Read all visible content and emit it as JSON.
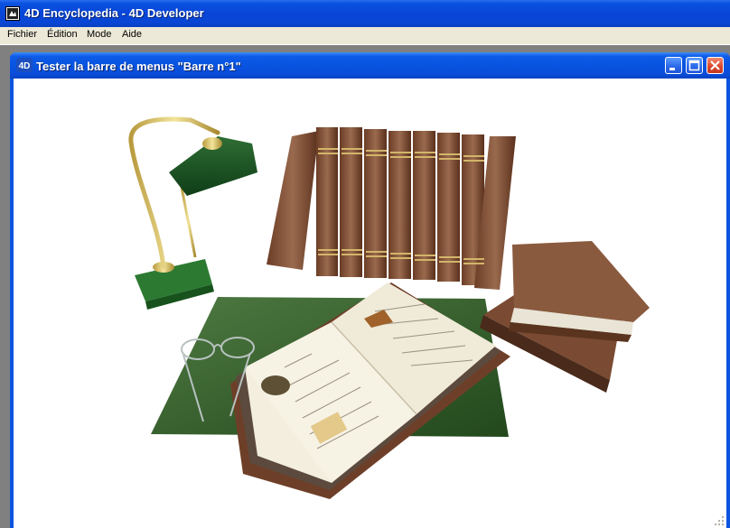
{
  "app": {
    "title": "4D Encyclopedia - 4D Developer",
    "icon": "4d-app-icon"
  },
  "menubar": {
    "items": [
      {
        "label": "Fichier"
      },
      {
        "label": "Édition"
      },
      {
        "label": "Mode"
      },
      {
        "label": "Aide"
      }
    ]
  },
  "child_window": {
    "title": "Tester la barre de menus \"Barre n°1\"",
    "icon_text": "4D",
    "buttons": [
      "minimize-icon",
      "maximize-icon",
      "close-icon"
    ]
  },
  "illustration": {
    "description_icon": "encyclopedia-books-illustration"
  }
}
